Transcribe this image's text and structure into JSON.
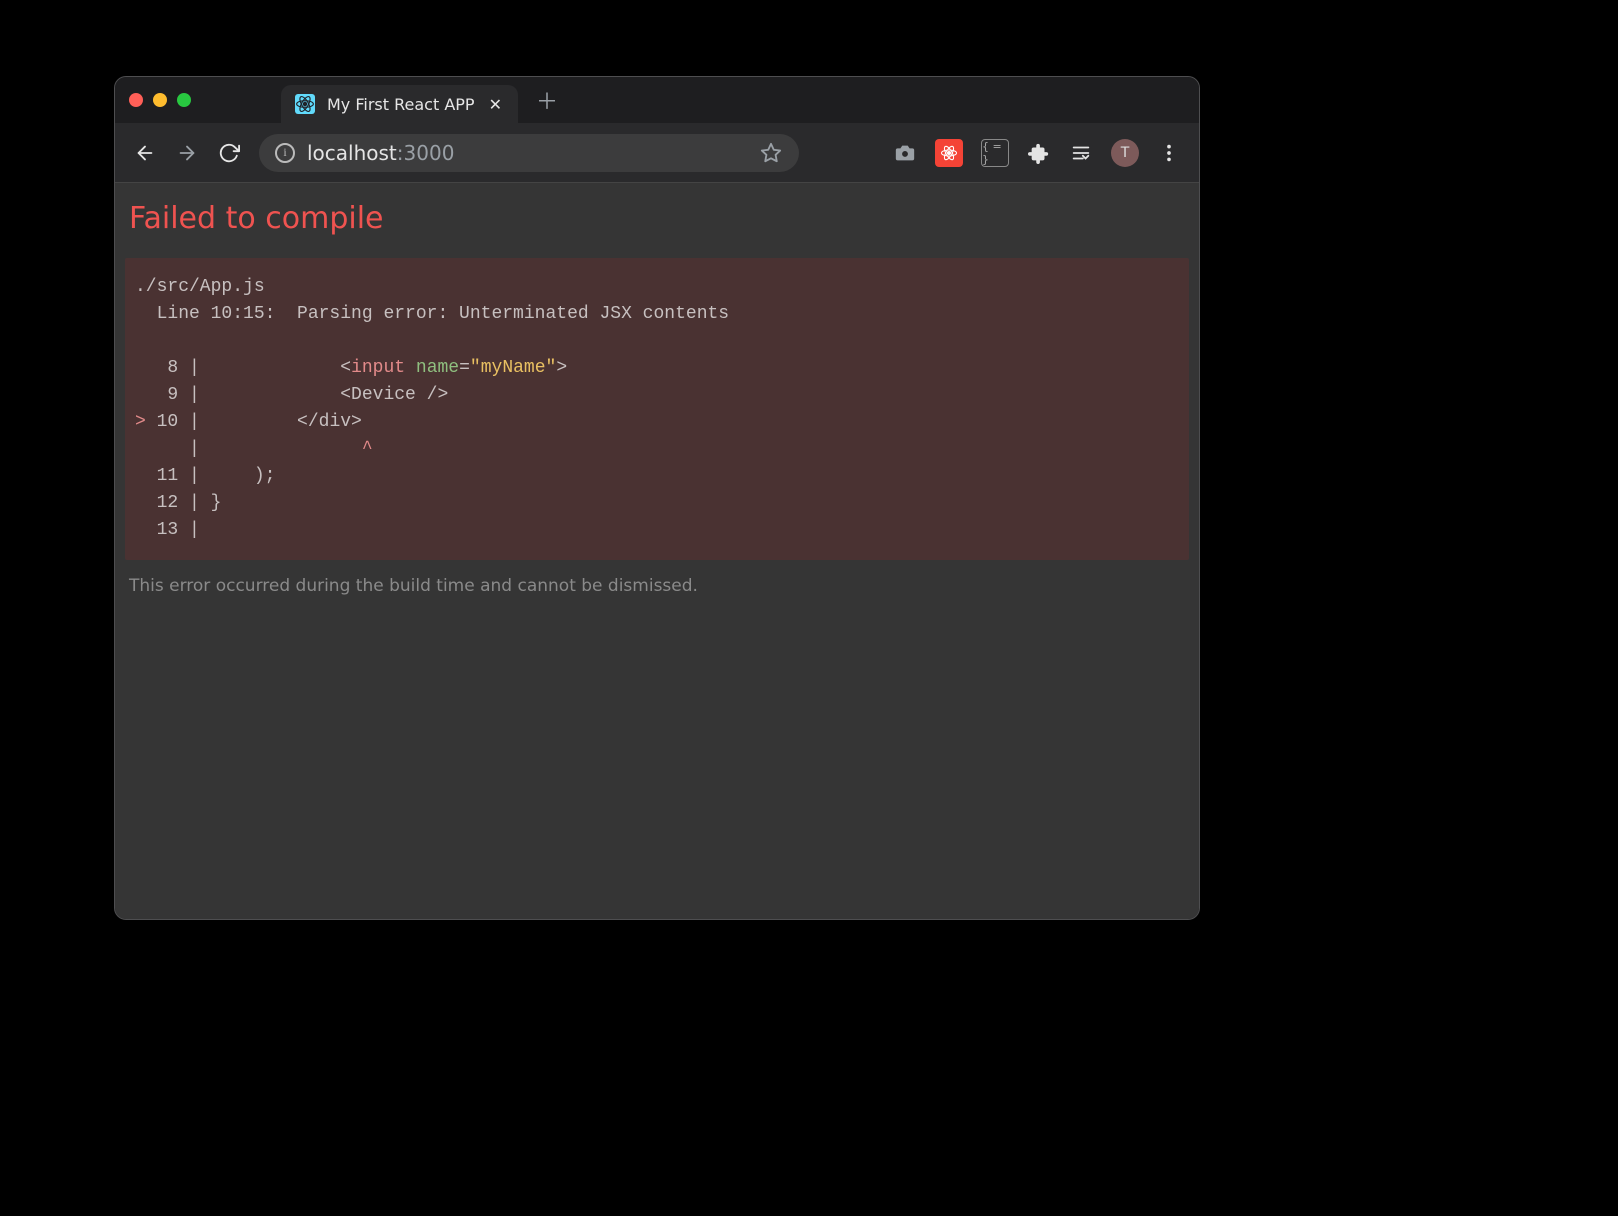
{
  "browser": {
    "tab_title": "My First React APP",
    "url_host": "localhost",
    "url_port": ":3000",
    "avatar_letter": "T",
    "json_ext_label": "{ = }"
  },
  "page": {
    "title": "Failed to compile",
    "file": "./src/App.js",
    "error_line": "  Line 10:15:  Parsing error: Unterminated JSX contents",
    "code": {
      "l8_gutter": "   8 | ",
      "l8_indent": "            ",
      "l8_open": "<",
      "l8_tag": "input",
      "l8_attr": "name",
      "l8_eq": "=",
      "l8_val": "\"myName\"",
      "l8_close": ">",
      "l9_gutter": "   9 | ",
      "l9_indent": "            ",
      "l9_txt": "<Device />",
      "l10_mark": "> ",
      "l10_gutter": "10 | ",
      "l10_indent": "        ",
      "l10_txt": "</div>",
      "caret_gutter": "     | ",
      "caret_indent": "              ",
      "caret": "^",
      "l11_gutter": "  11 | ",
      "l11_txt": "    );",
      "l12_gutter": "  12 | ",
      "l12_txt": "}",
      "l13_gutter": "  13 | "
    },
    "hint": "This error occurred during the build time and cannot be dismissed."
  }
}
